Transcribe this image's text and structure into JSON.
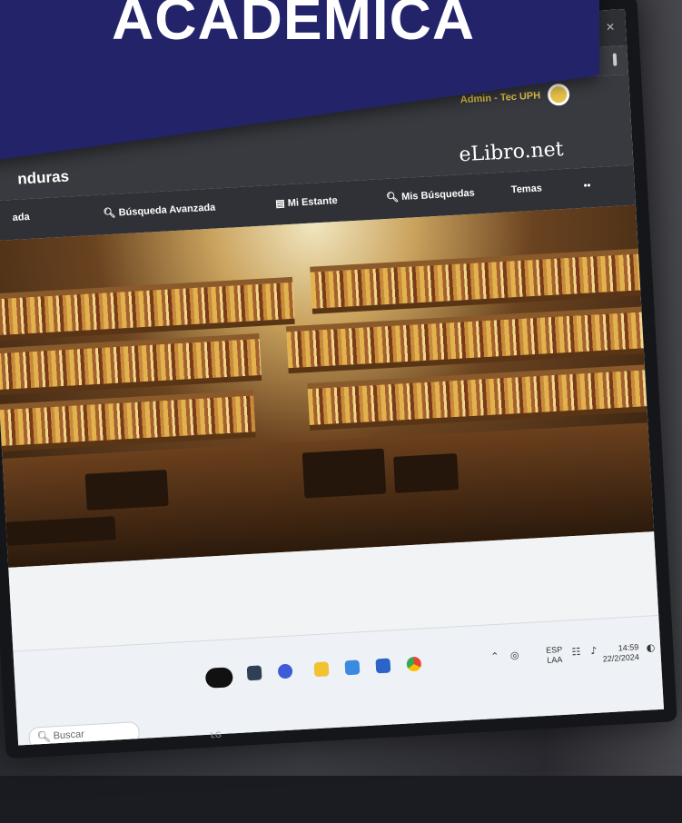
{
  "banner": {
    "title": "ACADÉMICA",
    "color": "#23236a"
  },
  "browser": {
    "window_controls": {
      "minimize": "–",
      "maximize": "⊡",
      "close": "✕"
    },
    "toolbar_icons": [
      "bookmark-icon",
      "profile-icon",
      "more-menu-icon"
    ]
  },
  "site": {
    "user_label": "Admin - Tec UPH",
    "brand_fragment": "nduras",
    "logo": "eLibro.net",
    "accent": "#e6c84a"
  },
  "nav": {
    "items": [
      {
        "id": "nav-item-simple-search",
        "label": "ada"
      },
      {
        "id": "nav-item-advanced-search",
        "label": "Búsqueda Avanzada",
        "icon": "search-icon"
      },
      {
        "id": "nav-item-my-shelf",
        "label": "Mi Estante",
        "icon": "shelf-icon"
      },
      {
        "id": "nav-item-my-searches",
        "label": "Mis Búsquedas",
        "icon": "search-icon"
      },
      {
        "id": "nav-item-topics",
        "label": "Temas"
      },
      {
        "id": "nav-item-more",
        "label": "••"
      }
    ]
  },
  "taskbar": {
    "search_placeholder": "Buscar",
    "apps": [
      "copilot-icon",
      "file-icon",
      "chat-icon",
      "folder-icon",
      "photos-icon",
      "store-icon",
      "chrome-icon"
    ],
    "tray": {
      "lang_top": "ESP",
      "lang_bottom": "LAA",
      "time": "14:59",
      "date": "22/2/2024"
    }
  },
  "monitor_brand": "LG"
}
